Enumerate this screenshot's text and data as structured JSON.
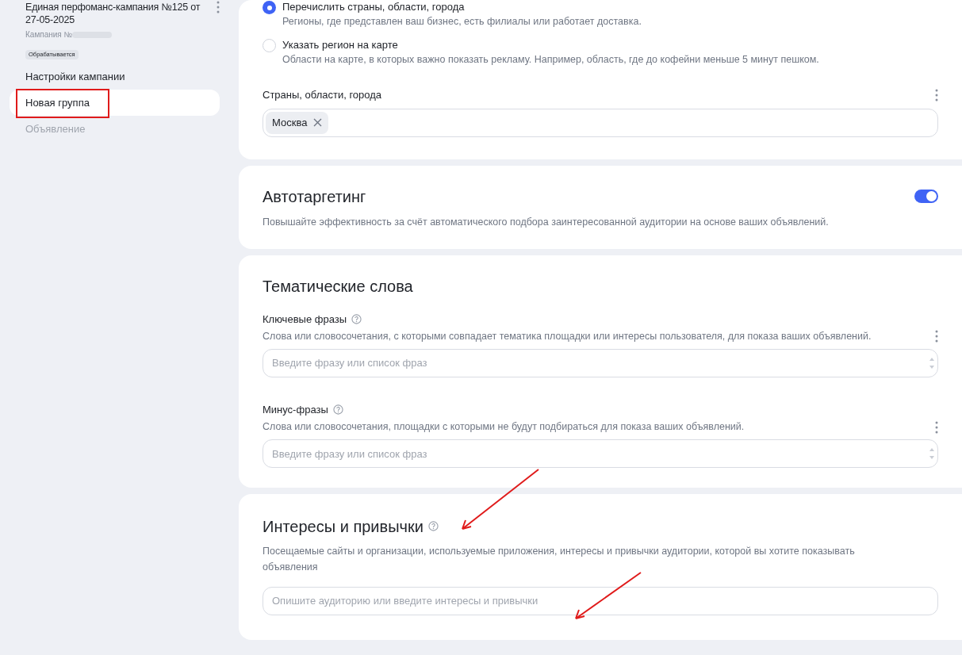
{
  "sidebar": {
    "campaign_title": "Единая перфоманс-кампания №125 от 27-05-2025",
    "campaign_id_label": "Кампания №",
    "status": "Обрабатывается",
    "nav": [
      {
        "label": "Настройки кампании",
        "selected": false,
        "disabled": false
      },
      {
        "label": "Новая группа",
        "selected": true,
        "disabled": false
      },
      {
        "label": "Объявление",
        "selected": false,
        "disabled": true
      }
    ]
  },
  "regions": {
    "options": [
      {
        "label": "Перечислить страны, области, города",
        "description": "Регионы, где представлен ваш бизнес, есть филиалы или работает доставка.",
        "selected": true
      },
      {
        "label": "Указать регион на карте",
        "description": "Области на карте, в которых важно показать рекламу. Например, область, где до кофейни меньше 5 минут пешком.",
        "selected": false
      }
    ],
    "field_label": "Страны, области, города",
    "tags": [
      "Москва"
    ]
  },
  "autotargeting": {
    "title": "Автотаргетинг",
    "description": "Повышайте эффективность за счёт автоматического подбора заинтересованной аудитории на основе ваших объявлений.",
    "on": true
  },
  "thematic": {
    "title": "Тематические слова",
    "fields": [
      {
        "label": "Ключевые фразы",
        "description": "Слова или словосочетания, с которыми совпадает тематика площадки или интересы пользователя, для показа ваших объявлений.",
        "placeholder": "Введите фразу или список фраз"
      },
      {
        "label": "Минус-фразы",
        "description": "Слова или словосочетания, площадки с которыми не будут подбираться для показа ваших объявлений.",
        "placeholder": "Введите фразу или список фраз"
      }
    ]
  },
  "interests": {
    "title": "Интересы и привычки",
    "description": "Посещаемые сайты и организации, используемые приложения, интересы и привычки аудитории, которой вы хотите показывать объявления",
    "placeholder": "Опишите аудиторию или введите интересы и привычки"
  }
}
